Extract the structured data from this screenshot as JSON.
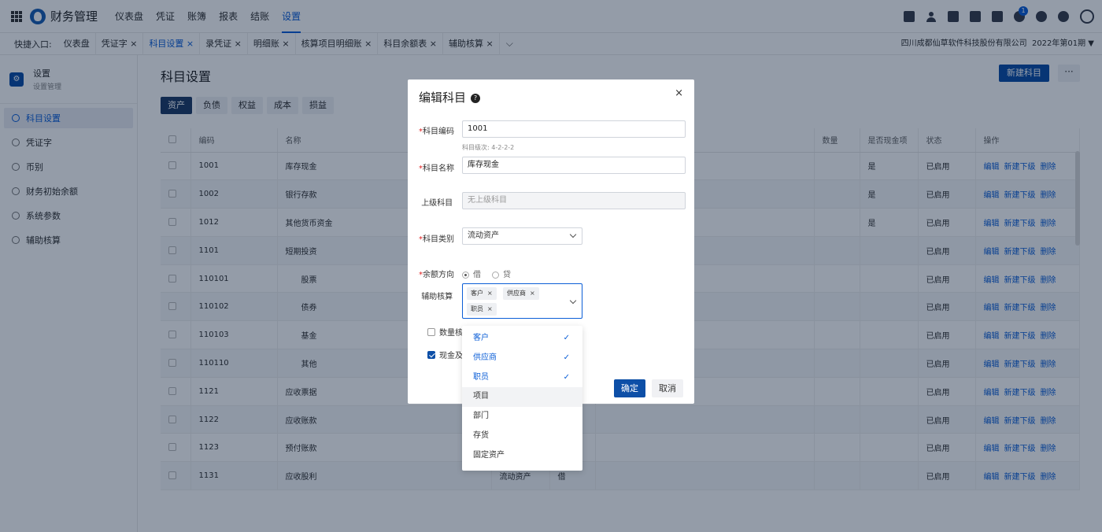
{
  "topbar": {
    "app_title": "财务管理",
    "nav": [
      "仪表盘",
      "凭证",
      "账簿",
      "报表",
      "结账",
      "设置"
    ],
    "active_nav": "设置",
    "notification_count": "1"
  },
  "quickbar": {
    "label": "快捷入口:",
    "tabs": [
      "仪表盘",
      "凭证字 ×",
      "科目设置 ×",
      "录凭证 ×",
      "明细账 ×",
      "核算项目明细账 ×",
      "科目余额表 ×",
      "辅助核算 ×"
    ],
    "more": "⌵",
    "company": "四川成都仙草软件科技股份有限公司",
    "period": "2022年第01期 ▼"
  },
  "sidebar": {
    "title": "设置",
    "subtitle": "设置管理",
    "items": [
      "科目设置",
      "凭证字",
      "币别",
      "财务初始余额",
      "系统参数",
      "辅助核算"
    ]
  },
  "main": {
    "page_title": "科目设置",
    "new_button": "新建科目",
    "more_button": "···",
    "category_tabs": [
      "资产",
      "负债",
      "权益",
      "成本",
      "损益"
    ],
    "columns": [
      "编码",
      "名称",
      "数量",
      "是否现金项",
      "状态",
      "操作"
    ],
    "rows": [
      {
        "code": "1001",
        "name": "库存现金",
        "type": "",
        "dir": "",
        "cash": "是",
        "status": "已启用"
      },
      {
        "code": "1002",
        "name": "银行存款",
        "type": "",
        "dir": "",
        "cash": "是",
        "status": "已启用"
      },
      {
        "code": "1012",
        "name": "其他货币资金",
        "type": "",
        "dir": "",
        "cash": "是",
        "status": "已启用"
      },
      {
        "code": "1101",
        "name": "短期投资",
        "type": "",
        "dir": "",
        "cash": "",
        "status": "已启用"
      },
      {
        "code": "110101",
        "name": "股票",
        "type": "",
        "dir": "",
        "cash": "",
        "status": "已启用"
      },
      {
        "code": "110102",
        "name": "债券",
        "type": "",
        "dir": "",
        "cash": "",
        "status": "已启用"
      },
      {
        "code": "110103",
        "name": "基金",
        "type": "",
        "dir": "",
        "cash": "",
        "status": "已启用"
      },
      {
        "code": "110110",
        "name": "其他",
        "type": "",
        "dir": "",
        "cash": "",
        "status": "已启用"
      },
      {
        "code": "1121",
        "name": "应收票据",
        "type": "",
        "dir": "",
        "cash": "",
        "status": "已启用"
      },
      {
        "code": "1122",
        "name": "应收账款",
        "type": "",
        "dir": "",
        "cash": "",
        "status": "已启用"
      },
      {
        "code": "1123",
        "name": "预付账款",
        "type": "",
        "dir": "",
        "cash": "",
        "status": "已启用"
      },
      {
        "code": "1131",
        "name": "应收股利",
        "type": "流动资产",
        "dir": "借",
        "cash": "",
        "status": "已启用"
      }
    ],
    "actions": [
      "编辑",
      "新建下级",
      "删除"
    ]
  },
  "modal": {
    "title": "编辑科目",
    "close": "×",
    "code_label": "科目编码",
    "code_value": "1001",
    "level_hint": "科目级次: 4-2-2-2",
    "name_label": "科目名称",
    "name_value": "库存现金",
    "parent_label": "上级科目",
    "parent_placeholder": "无上级科目",
    "category_label": "科目类别",
    "category_value": "流动资产",
    "direction_label": "余额方向",
    "direction_debit": "借",
    "direction_credit": "贷",
    "aux_label": "辅助核算",
    "aux_tags": [
      "客户",
      "供应商",
      "职员"
    ],
    "qty_label": "数量核",
    "cash_label": "现金及",
    "ok": "确定",
    "cancel": "取消"
  },
  "dropdown": {
    "options": [
      {
        "label": "客户",
        "selected": true
      },
      {
        "label": "供应商",
        "selected": true
      },
      {
        "label": "职员",
        "selected": true
      },
      {
        "label": "项目",
        "selected": false
      },
      {
        "label": "部门",
        "selected": false
      },
      {
        "label": "存货",
        "selected": false
      },
      {
        "label": "固定资产",
        "selected": false
      }
    ],
    "check": "✓"
  }
}
